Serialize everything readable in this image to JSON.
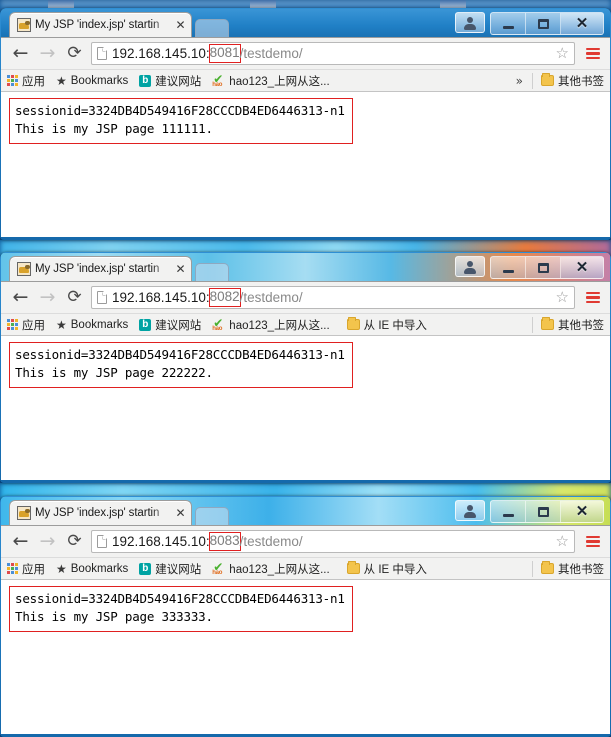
{
  "browser": {
    "tab": {
      "title": "My JSP 'index.jsp' startin",
      "close_label": "✕",
      "favicon": "jsp-page-icon"
    },
    "toolbar": {
      "back": "←",
      "forward": "→",
      "reload": "⟳",
      "star": "☆",
      "menu": "hamburger-menu-icon"
    },
    "bookmarks": {
      "apps": "应用",
      "bookmarks": "Bookmarks",
      "bing": "建议网站",
      "hao123": "hao123_上网从这...",
      "ie_import": "从 IE 中导入",
      "overflow": "»",
      "other": "其他书签"
    },
    "window_controls": {
      "user": "user-account-icon",
      "minimize": "—",
      "maximize": "▢",
      "close": "✕"
    }
  },
  "colors": {
    "accent_red": "#e02020",
    "menu_red": "#e03a32",
    "aero_blue": "#1e7fcf",
    "chrome_gray": "#f2f2f1"
  },
  "windows": [
    {
      "id": "window-8081",
      "url": {
        "host": "192.168.145.10:",
        "port": "8081",
        "path": "/testdemo/"
      },
      "content": {
        "line1": "sessionid=3324DB4D549416F28CCCDB4ED6446313-n1",
        "line2": "This is my JSP page 111111."
      },
      "bookmarks_overflow": "»"
    },
    {
      "id": "window-8082",
      "url": {
        "host": "192.168.145.10:",
        "port": "8082",
        "path": "/testdemo/"
      },
      "content": {
        "line1": "sessionid=3324DB4D549416F28CCCDB4ED6446313-n1",
        "line2": "This is my JSP page 222222."
      },
      "bookmarks_overflow": ""
    },
    {
      "id": "window-8083",
      "url": {
        "host": "192.168.145.10:",
        "port": "8083",
        "path": "/testdemo/"
      },
      "content": {
        "line1": "sessionid=3324DB4D549416F28CCCDB4ED6446313-n1",
        "line2": "This is my JSP page 333333."
      },
      "bookmarks_overflow": ""
    }
  ]
}
